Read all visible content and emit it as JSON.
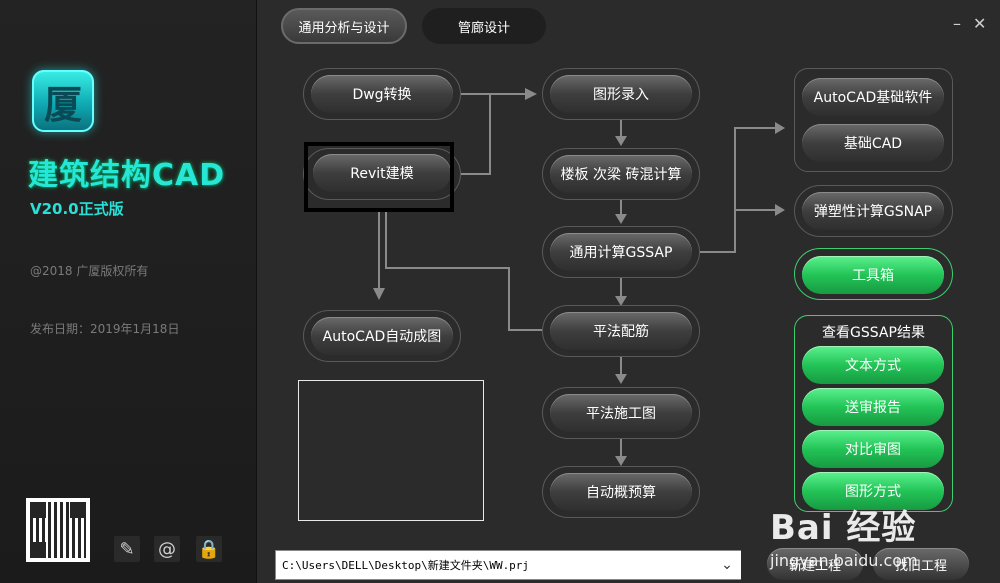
{
  "sidebar": {
    "logo_glyph": "厦",
    "app_title": "建筑结构CAD",
    "app_version": "V20.0正式版",
    "copyright": "@2018 广厦版权所有",
    "release_date": "发布日期：2019年1月18日",
    "icons": [
      "edit-icon",
      "at-icon",
      "lock-icon"
    ]
  },
  "tabs": [
    {
      "label": "通用分析与设计",
      "active": true
    },
    {
      "label": "管廊设计",
      "active": false
    }
  ],
  "window": {
    "minimize": "–",
    "close": "✕"
  },
  "flow": {
    "dwg": "Dwg转换",
    "revit": "Revit建模",
    "autocad_auto": "AutoCAD自动成图",
    "graphic_input": "图形录入",
    "slab_calc": "楼板 次梁 砖混计算",
    "gssap": "通用计算GSSAP",
    "reinforce": "平法配筋",
    "construction_drawing": "平法施工图",
    "budget": "自动概预算",
    "autocad_base": "AutoCAD基础软件",
    "base_cad": "基础CAD",
    "gsnap": "弹塑性计算GSNAP",
    "toolbox": "工具箱"
  },
  "results": {
    "title": "查看GSSAP结果",
    "items": [
      "文本方式",
      "送审报告",
      "对比审图",
      "图形方式"
    ]
  },
  "footer": {
    "path": "C:\\Users\\DELL\\Desktop\\新建文件夹\\WW.prj",
    "new_project": "新建工程",
    "open_project": "找旧工程"
  },
  "watermark": {
    "main": "Bai 经验",
    "sub": "jingyan.baidu.com"
  },
  "colors": {
    "accent_green": "#22c457",
    "title_cyan": "#27e6d6"
  }
}
